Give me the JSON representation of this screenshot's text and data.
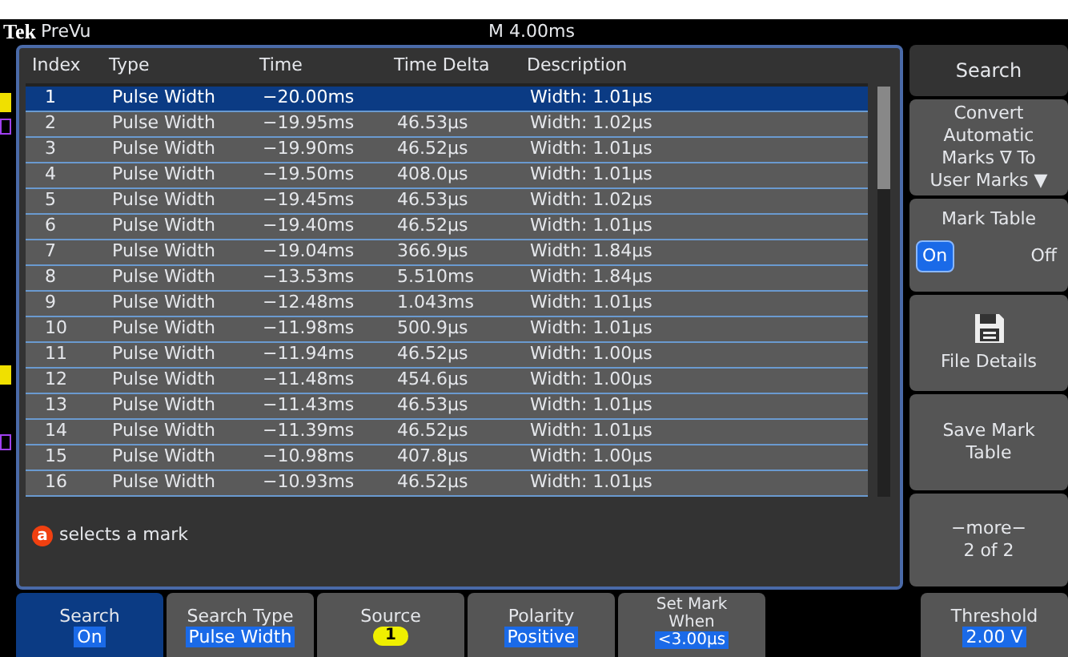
{
  "header": {
    "brand": "Tek",
    "mode": "PreVu",
    "timebase": "M 4.00ms"
  },
  "table": {
    "columns": [
      "Index",
      "Type",
      "Time",
      "Time Delta",
      "Description"
    ],
    "rows": [
      {
        "cells": [
          "1",
          "Pulse Width",
          "−20.00ms",
          "",
          "Width: 1.01μs"
        ],
        "selected": true
      },
      {
        "cells": [
          "2",
          "Pulse Width",
          "−19.95ms",
          "46.53μs",
          "Width: 1.02μs"
        ],
        "selected": false
      },
      {
        "cells": [
          "3",
          "Pulse Width",
          "−19.90ms",
          "46.52μs",
          "Width: 1.01μs"
        ],
        "selected": false
      },
      {
        "cells": [
          "4",
          "Pulse Width",
          "−19.50ms",
          "408.0μs",
          "Width: 1.01μs"
        ],
        "selected": false
      },
      {
        "cells": [
          "5",
          "Pulse Width",
          "−19.45ms",
          "46.53μs",
          "Width: 1.02μs"
        ],
        "selected": false
      },
      {
        "cells": [
          "6",
          "Pulse Width",
          "−19.40ms",
          "46.52μs",
          "Width: 1.01μs"
        ],
        "selected": false
      },
      {
        "cells": [
          "7",
          "Pulse Width",
          "−19.04ms",
          "366.9μs",
          "Width: 1.84μs"
        ],
        "selected": false
      },
      {
        "cells": [
          "8",
          "Pulse Width",
          "−13.53ms",
          "5.510ms",
          "Width: 1.84μs"
        ],
        "selected": false
      },
      {
        "cells": [
          "9",
          "Pulse Width",
          "−12.48ms",
          "1.043ms",
          "Width: 1.01μs"
        ],
        "selected": false
      },
      {
        "cells": [
          "10",
          "Pulse Width",
          "−11.98ms",
          "500.9μs",
          "Width: 1.01μs"
        ],
        "selected": false
      },
      {
        "cells": [
          "11",
          "Pulse Width",
          "−11.94ms",
          "46.52μs",
          "Width: 1.00μs"
        ],
        "selected": false
      },
      {
        "cells": [
          "12",
          "Pulse Width",
          "−11.48ms",
          "454.6μs",
          "Width: 1.00μs"
        ],
        "selected": false
      },
      {
        "cells": [
          "13",
          "Pulse Width",
          "−11.43ms",
          "46.53μs",
          "Width: 1.01μs"
        ],
        "selected": false
      },
      {
        "cells": [
          "14",
          "Pulse Width",
          "−11.39ms",
          "46.52μs",
          "Width: 1.01μs"
        ],
        "selected": false
      },
      {
        "cells": [
          "15",
          "Pulse Width",
          "−10.98ms",
          "407.8μs",
          "Width: 1.00μs"
        ],
        "selected": false
      },
      {
        "cells": [
          "16",
          "Pulse Width",
          "−10.93ms",
          "46.52μs",
          "Width: 1.01μs"
        ],
        "selected": false
      }
    ]
  },
  "message": {
    "badge": "a",
    "text": "selects a mark"
  },
  "side_menu": [
    {
      "kind": "title",
      "label": "Search"
    },
    {
      "kind": "button",
      "label": "Convert Automatic Marks ∇ To User Marks ▼"
    },
    {
      "kind": "toggle",
      "label": "Mark Table",
      "options": [
        {
          "label": "On",
          "selected": true
        },
        {
          "label": "Off",
          "selected": false
        }
      ]
    },
    {
      "kind": "icon_button",
      "label": "File Details"
    },
    {
      "kind": "button",
      "label": "Save Mark Table"
    },
    {
      "kind": "more",
      "label": "−more−",
      "value": "2 of 2"
    }
  ],
  "bottom_menu": [
    {
      "kind": "highlight",
      "label": "Search",
      "value": "On",
      "selected": true
    },
    {
      "kind": "highlight",
      "label": "Search Type",
      "value": "Pulse Width",
      "selected": false
    },
    {
      "kind": "channel",
      "label": "Source",
      "value": "1",
      "selected": false
    },
    {
      "kind": "highlight",
      "label": "Polarity",
      "value": "Positive",
      "selected": false
    },
    {
      "kind": "highlight",
      "label": "Set Mark When",
      "value": "<3.00μs",
      "selected": false
    },
    {
      "kind": "highlight",
      "label": "Threshold",
      "value": "2.00 V",
      "selected": false
    }
  ]
}
